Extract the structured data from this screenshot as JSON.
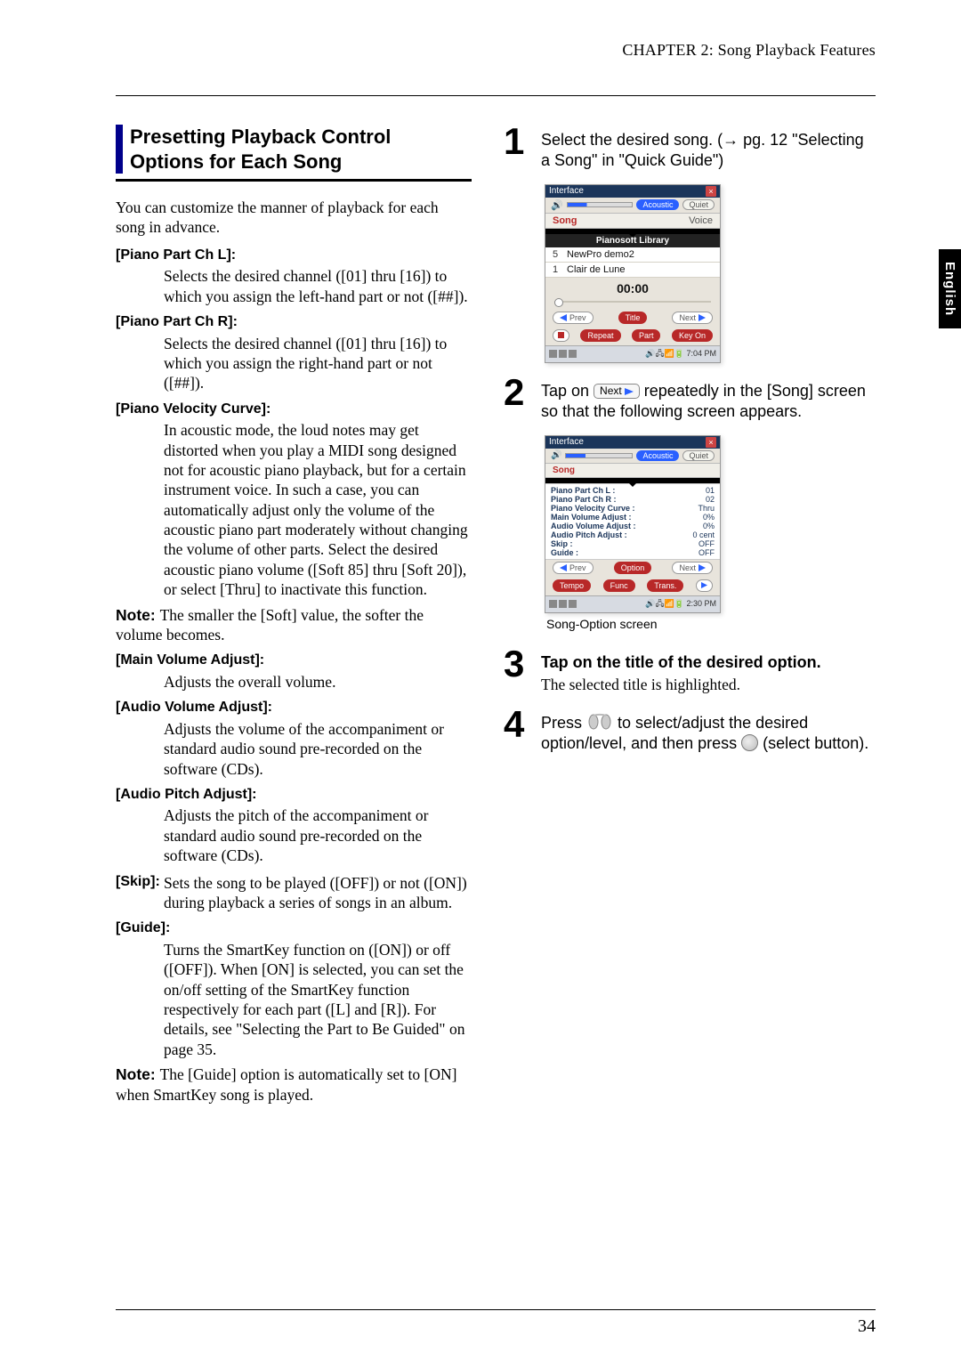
{
  "header": {
    "running_head": "CHAPTER 2: Song Playback Features"
  },
  "side_tab": "English",
  "page_number": "34",
  "section": {
    "title_line1": "Presetting Playback Control",
    "title_line2": "Options for Each Song",
    "intro": "You can customize the manner of playback for each song in advance."
  },
  "defs": {
    "piano_part_l": {
      "label": "[Piano Part Ch L]:",
      "body": "Selects the desired channel ([01] thru [16]) to which you assign the left-hand part or not ([##])."
    },
    "piano_part_r": {
      "label": "[Piano Part Ch R]:",
      "body": "Selects the desired channel ([01] thru [16]) to which you assign the right-hand part or not ([##])."
    },
    "velocity": {
      "label": "[Piano Velocity Curve]:",
      "body": "In acoustic mode, the loud notes may get distorted when you play a MIDI song designed not for acoustic piano playback, but for a certain instrument voice. In such a case, you can automatically adjust only the volume of the acoustic piano part moderately without changing the volume of other parts. Select the desired acoustic piano volume ([Soft 85] thru [Soft 20]), or select [Thru] to inactivate this function.",
      "note": "The smaller the [Soft] value, the softer the volume becomes."
    },
    "main_vol": {
      "label": "[Main Volume Adjust]:",
      "body": "Adjusts the overall volume."
    },
    "audio_vol": {
      "label": "[Audio Volume Adjust]:",
      "body": "Adjusts the volume of the accompaniment or standard audio sound pre-recorded on the software (CDs)."
    },
    "audio_pitch": {
      "label": "[Audio Pitch Adjust]:",
      "body": "Adjusts the pitch of the accompaniment or standard audio sound pre-recorded on the software (CDs)."
    },
    "skip": {
      "label": "[Skip]:",
      "body": "Sets the song to be played ([OFF]) or not ([ON]) during playback a series of songs in an album."
    },
    "guide": {
      "label": "[Guide]:",
      "body": "Turns the SmartKey function on ([ON]) or off ([OFF]). When [ON] is selected, you can set the on/off setting of the SmartKey function respectively for each part ([L] and [R]). For details, see \"Selecting the Part to Be Guided\" on page 35.",
      "note": "The [Guide] option is automatically set to [ON] when SmartKey song is played."
    }
  },
  "steps": {
    "s1": "Select the desired song. (→ pg. 12 \"Selecting a Song\" in \"Quick Guide\")",
    "s2_a": "Tap on ",
    "s2_chip": "Next",
    "s2_b": " repeatedly in the [Song] screen so that the following screen appears.",
    "s3": "Tap on the title of the desired option.",
    "s3_sub": "The selected title is highlighted.",
    "s4_a": "Press ",
    "s4_b": " to select/adjust the desired option/level, and then press ",
    "s4_c": " (select button)."
  },
  "shot1": {
    "win_title": "Interface",
    "mode_acoustic": "Acoustic",
    "mode_quiet": "Quiet",
    "tab_song": "Song",
    "tab_voice": "Voice",
    "library": "Pianosoft Library",
    "rows": [
      {
        "n": "5",
        "t": "NewPro demo2"
      },
      {
        "n": "1",
        "t": "Clair de Lune"
      }
    ],
    "time": "00:00",
    "btn_prev": "Prev",
    "btn_title": "Title",
    "btn_next": "Next",
    "btn_stop": "",
    "btn_repeat": "Repeat",
    "btn_part": "Part",
    "btn_keyon": "Key On",
    "task_time": "7:04 PM"
  },
  "shot2": {
    "win_title": "Interface",
    "mode_acoustic": "Acoustic",
    "mode_quiet": "Quiet",
    "tab_song": "Song",
    "opts": [
      [
        "Piano Part Ch L :",
        "01"
      ],
      [
        "Piano Part Ch R :",
        "02"
      ],
      [
        "Piano Velocity Curve :",
        "Thru"
      ],
      [
        "Main Volume Adjust :",
        "0%"
      ],
      [
        "Audio Volume Adjust :",
        "0%"
      ],
      [
        "Audio Pitch Adjust :",
        "0 cent"
      ],
      [
        "Skip :",
        "OFF"
      ],
      [
        "Guide :",
        "OFF"
      ]
    ],
    "btn_prev": "Prev",
    "btn_option": "Option",
    "btn_next": "Next",
    "btn_tempo": "Tempo",
    "btn_func": "Func",
    "btn_trans": "Trans.",
    "task_time": "2:30 PM",
    "caption": "Song-Option screen"
  }
}
